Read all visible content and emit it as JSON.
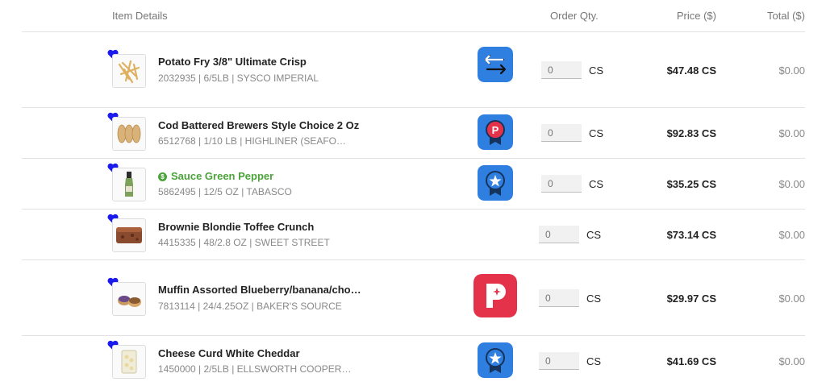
{
  "header": {
    "item_details": "Item Details",
    "order_qty": "Order Qty.",
    "price": "Price ($)",
    "total": "Total ($)"
  },
  "colors": {
    "heart": "#1a1aee",
    "green": "#4ca33b",
    "badge_blue": "#2f7fe0",
    "badge_red": "#e4324a"
  },
  "items": [
    {
      "name": "Potato Fry 3/8\" Ultimate Crisp",
      "details": "2032935 | 6/5LB | SYSCO IMPERIAL",
      "badge": "substitute-arrows-icon",
      "qty_placeholder": "0",
      "unit": "CS",
      "price": "$47.48 CS",
      "total": "$0.00"
    },
    {
      "name": "Cod Battered Brewers Style Choice 2 Oz",
      "details": "6512768 | 1/10 LB | HIGHLINER (SEAFO…",
      "badge": "promo-ribbon-icon",
      "qty_placeholder": "0",
      "unit": "CS",
      "price": "$92.83 CS",
      "total": "$0.00"
    },
    {
      "name": "Sauce Green Pepper",
      "details": "5862495 | 12/5 OZ | TABASCO",
      "badge": "star-ribbon-icon",
      "qty_placeholder": "0",
      "unit": "CS",
      "price": "$35.25 CS",
      "total": "$0.00"
    },
    {
      "name": "Brownie Blondie Toffee Crunch",
      "details": "4415335 | 48/2.8 OZ | SWEET STREET",
      "badge": "",
      "qty_placeholder": "0",
      "unit": "CS",
      "price": "$73.14 CS",
      "total": "$0.00"
    },
    {
      "name": "Muffin Assorted Blueberry/banana/cho…",
      "details": "7813114 | 24/4.25OZ | BAKER'S SOURCE",
      "badge": "promo-p-icon",
      "qty_placeholder": "0",
      "unit": "CS",
      "price": "$29.97 CS",
      "total": "$0.00"
    },
    {
      "name": "Cheese Curd White Cheddar",
      "details": "1450000 | 2/5LB | ELLSWORTH COOPER…",
      "badge": "star-ribbon-icon",
      "qty_placeholder": "0",
      "unit": "CS",
      "price": "$41.69 CS",
      "total": "$0.00"
    }
  ]
}
